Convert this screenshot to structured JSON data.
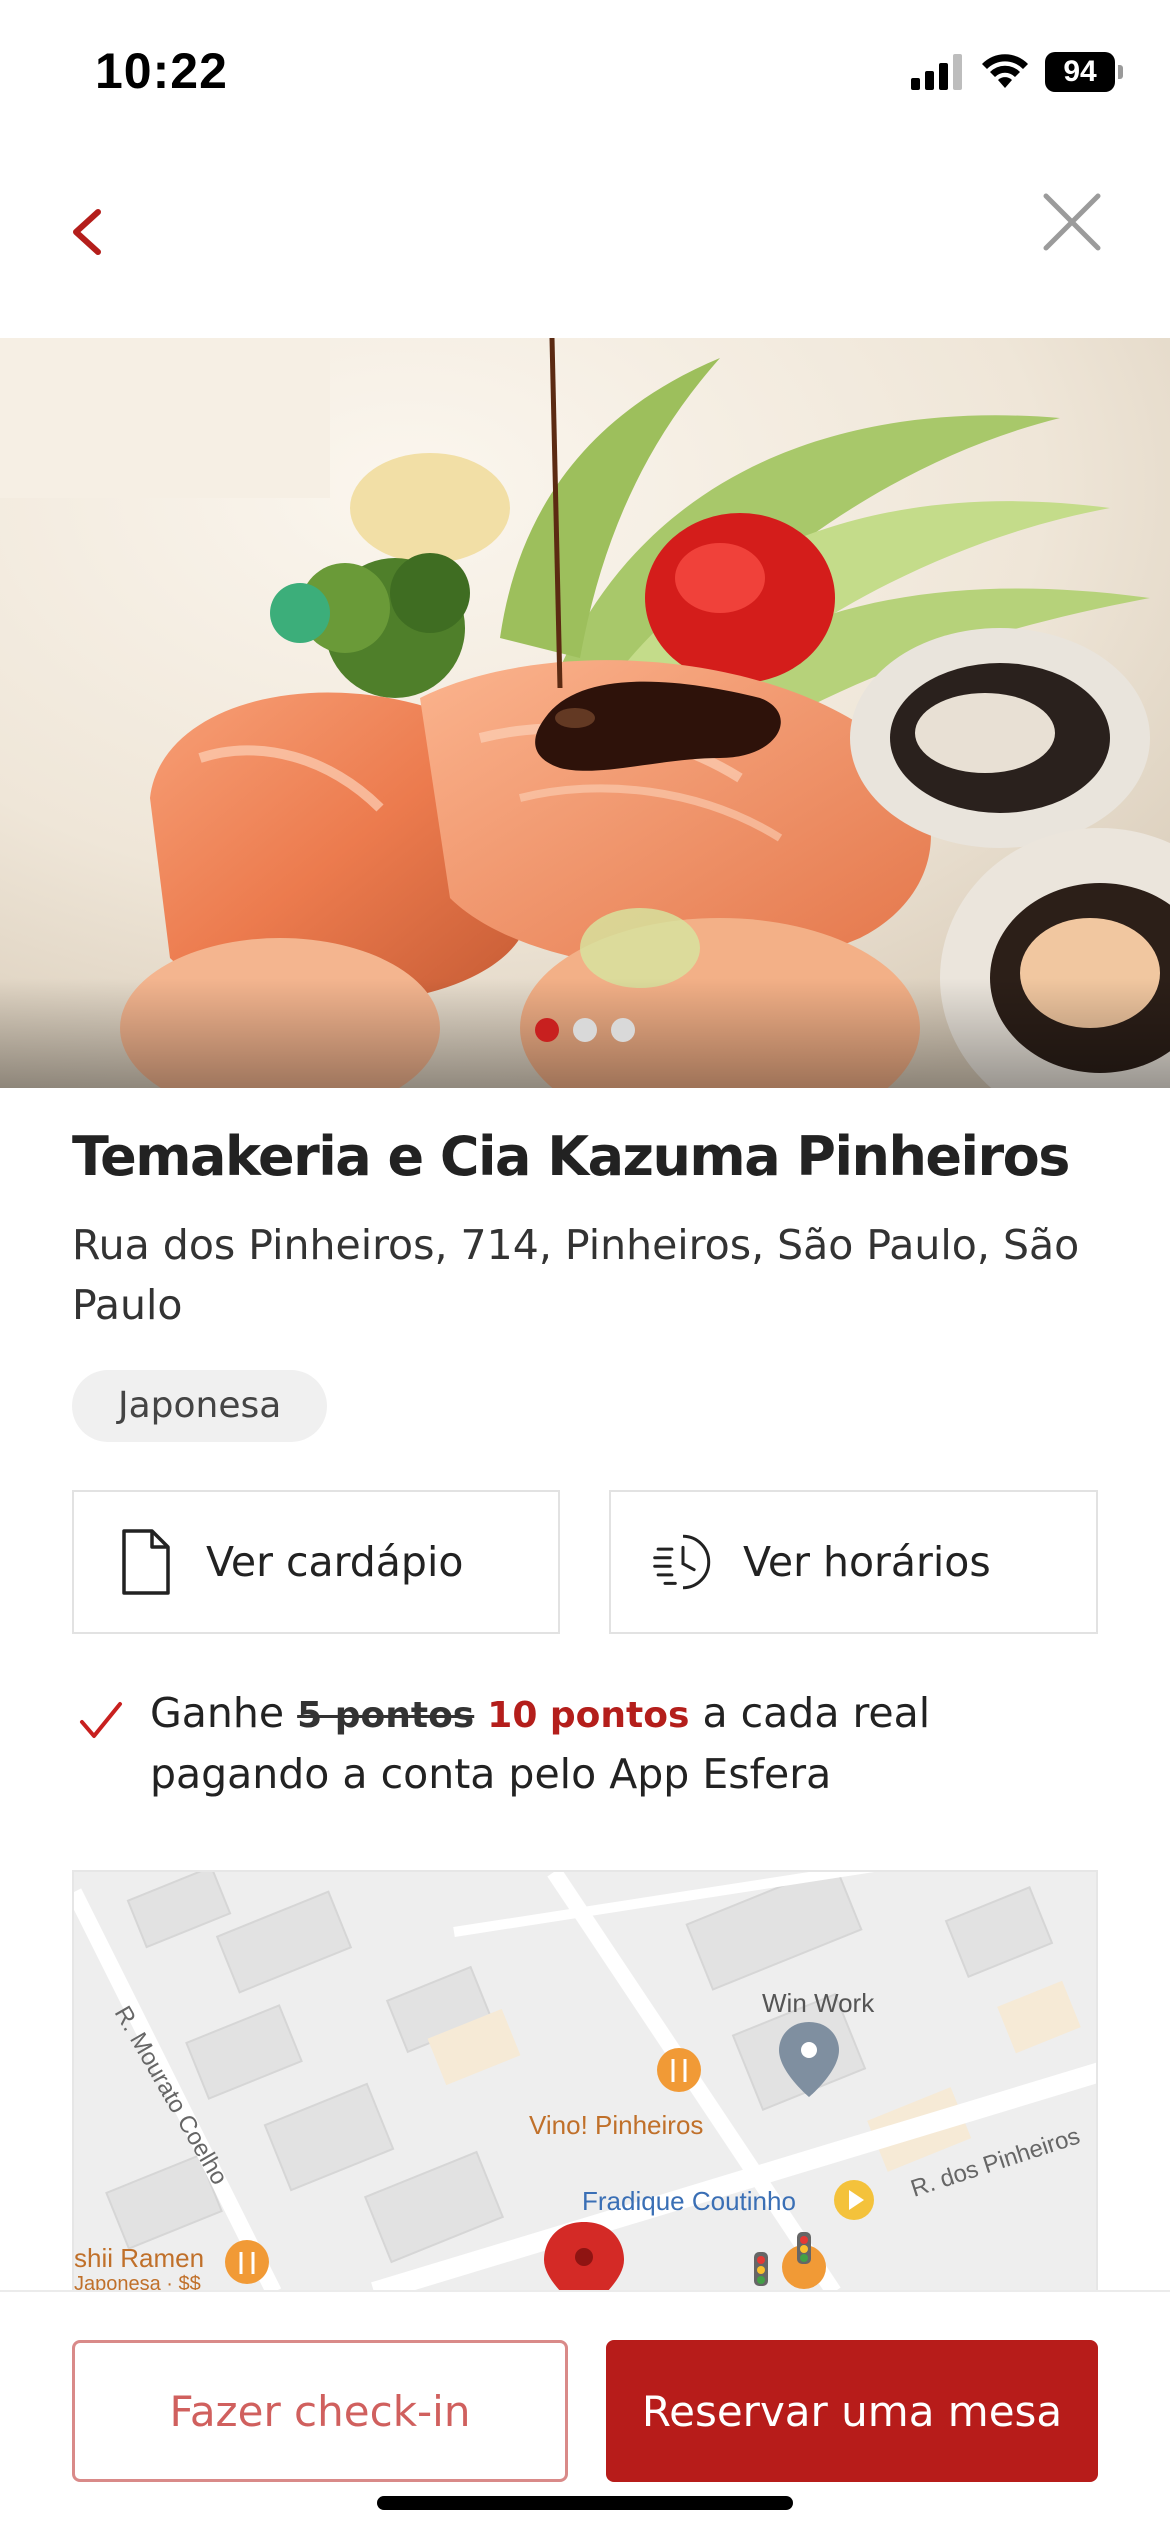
{
  "status": {
    "time": "10:22",
    "battery": "94",
    "icons": [
      "signal-icon",
      "wifi-icon",
      "battery-icon"
    ]
  },
  "nav": {
    "back_icon": "chevron-left-icon",
    "close_icon": "close-icon"
  },
  "gallery": {
    "total": 3,
    "active_index": 0,
    "description": "sushi"
  },
  "restaurant": {
    "name": "Temakeria e Cia Kazuma Pinheiros",
    "address": "Rua dos Pinheiros, 714, Pinheiros, São Paulo, São Paulo",
    "cuisine_tag": "Japonesa"
  },
  "actions": {
    "menu_label": "Ver cardápio",
    "hours_label": "Ver horários"
  },
  "points": {
    "prefix": "Ganhe",
    "old": "5 pontos",
    "new": "10 pontos",
    "suffix": "a cada real pagando a conta pelo App Esfera"
  },
  "map": {
    "labels": {
      "win_work": "Win Work",
      "vino": "Vino! Pinheiros",
      "fradique": "Fradique Coutinho",
      "rua_pinheiros": "R. dos Pinheiros",
      "mourato": "R. Mourato Coelho",
      "ramen": "shii Ramen",
      "ramen_sub": "Japonesa · $$"
    }
  },
  "footer": {
    "checkin_label": "Fazer check-in",
    "reserve_label": "Reservar uma mesa"
  },
  "colors": {
    "accent": "#b71c1a",
    "accent_light": "#d0605e",
    "muted": "#f0f0f0"
  }
}
